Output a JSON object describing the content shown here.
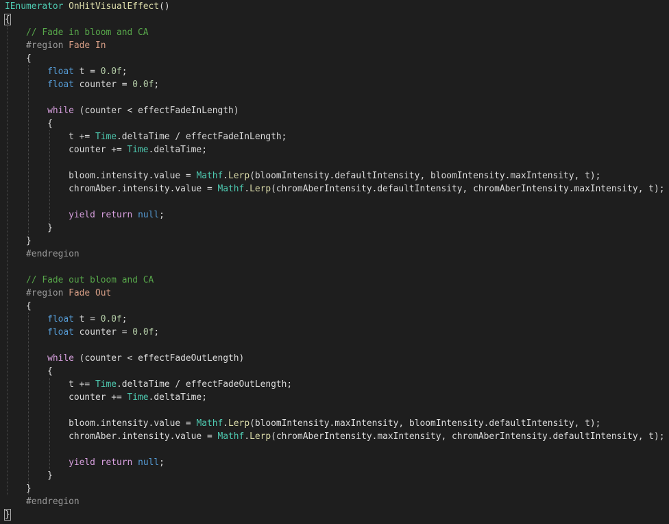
{
  "editor": {
    "lines": [
      [
        [
          "IEnumerator",
          "type"
        ],
        [
          " ",
          "op"
        ],
        [
          "OnHitVisualEffect",
          "fn"
        ],
        [
          "()",
          "op"
        ]
      ],
      [
        [
          "{",
          "op"
        ]
      ],
      [
        [
          "    ",
          "op"
        ],
        [
          "// Fade in bloom and CA",
          "cm"
        ]
      ],
      [
        [
          "    ",
          "op"
        ],
        [
          "#region",
          "pp"
        ],
        [
          " ",
          "op"
        ],
        [
          "Fade In",
          "rn"
        ]
      ],
      [
        [
          "    ",
          "op"
        ],
        [
          "{",
          "op"
        ]
      ],
      [
        [
          "        ",
          "op"
        ],
        [
          "float",
          "kw"
        ],
        [
          " ",
          "op"
        ],
        [
          "t",
          "var"
        ],
        [
          " = ",
          "op"
        ],
        [
          "0.0f",
          "num"
        ],
        [
          ";",
          "op"
        ]
      ],
      [
        [
          "        ",
          "op"
        ],
        [
          "float",
          "kw"
        ],
        [
          " ",
          "op"
        ],
        [
          "counter",
          "var"
        ],
        [
          " = ",
          "op"
        ],
        [
          "0.0f",
          "num"
        ],
        [
          ";",
          "op"
        ]
      ],
      [],
      [
        [
          "        ",
          "op"
        ],
        [
          "while",
          "ctrl"
        ],
        [
          " (",
          "op"
        ],
        [
          "counter",
          "var"
        ],
        [
          " < ",
          "op"
        ],
        [
          "effectFadeInLength",
          "var"
        ],
        [
          ")",
          "op"
        ]
      ],
      [
        [
          "        ",
          "op"
        ],
        [
          "{",
          "op"
        ]
      ],
      [
        [
          "            ",
          "op"
        ],
        [
          "t",
          "var"
        ],
        [
          " += ",
          "op"
        ],
        [
          "Time",
          "type"
        ],
        [
          ".",
          "op"
        ],
        [
          "deltaTime",
          "var"
        ],
        [
          " / ",
          "op"
        ],
        [
          "effectFadeInLength",
          "var"
        ],
        [
          ";",
          "op"
        ]
      ],
      [
        [
          "            ",
          "op"
        ],
        [
          "counter",
          "var"
        ],
        [
          " += ",
          "op"
        ],
        [
          "Time",
          "type"
        ],
        [
          ".",
          "op"
        ],
        [
          "deltaTime",
          "var"
        ],
        [
          ";",
          "op"
        ]
      ],
      [],
      [
        [
          "            ",
          "op"
        ],
        [
          "bloom",
          "var"
        ],
        [
          ".",
          "op"
        ],
        [
          "intensity",
          "var"
        ],
        [
          ".",
          "op"
        ],
        [
          "value",
          "var"
        ],
        [
          " = ",
          "op"
        ],
        [
          "Mathf",
          "type"
        ],
        [
          ".",
          "op"
        ],
        [
          "Lerp",
          "fn"
        ],
        [
          "(",
          "op"
        ],
        [
          "bloomIntensity",
          "var"
        ],
        [
          ".",
          "op"
        ],
        [
          "defaultIntensity",
          "var"
        ],
        [
          ", ",
          "op"
        ],
        [
          "bloomIntensity",
          "var"
        ],
        [
          ".",
          "op"
        ],
        [
          "maxIntensity",
          "var"
        ],
        [
          ", ",
          "op"
        ],
        [
          "t",
          "var"
        ],
        [
          ");",
          "op"
        ]
      ],
      [
        [
          "            ",
          "op"
        ],
        [
          "chromAber",
          "var"
        ],
        [
          ".",
          "op"
        ],
        [
          "intensity",
          "var"
        ],
        [
          ".",
          "op"
        ],
        [
          "value",
          "var"
        ],
        [
          " = ",
          "op"
        ],
        [
          "Mathf",
          "type"
        ],
        [
          ".",
          "op"
        ],
        [
          "Lerp",
          "fn"
        ],
        [
          "(",
          "op"
        ],
        [
          "chromAberIntensity",
          "var"
        ],
        [
          ".",
          "op"
        ],
        [
          "defaultIntensity",
          "var"
        ],
        [
          ", ",
          "op"
        ],
        [
          "chromAberIntensity",
          "var"
        ],
        [
          ".",
          "op"
        ],
        [
          "maxIntensity",
          "var"
        ],
        [
          ", ",
          "op"
        ],
        [
          "t",
          "var"
        ],
        [
          ");",
          "op"
        ]
      ],
      [],
      [
        [
          "            ",
          "op"
        ],
        [
          "yield",
          "ctrl"
        ],
        [
          " ",
          "op"
        ],
        [
          "return",
          "ctrl"
        ],
        [
          " ",
          "op"
        ],
        [
          "null",
          "kw"
        ],
        [
          ";",
          "op"
        ]
      ],
      [
        [
          "        ",
          "op"
        ],
        [
          "}",
          "op"
        ]
      ],
      [
        [
          "    ",
          "op"
        ],
        [
          "}",
          "op"
        ]
      ],
      [
        [
          "    ",
          "op"
        ],
        [
          "#endregion",
          "pp"
        ]
      ],
      [],
      [
        [
          "    ",
          "op"
        ],
        [
          "// Fade out bloom and CA",
          "cm"
        ]
      ],
      [
        [
          "    ",
          "op"
        ],
        [
          "#region",
          "pp"
        ],
        [
          " ",
          "op"
        ],
        [
          "Fade Out",
          "rn"
        ]
      ],
      [
        [
          "    ",
          "op"
        ],
        [
          "{",
          "op"
        ]
      ],
      [
        [
          "        ",
          "op"
        ],
        [
          "float",
          "kw"
        ],
        [
          " ",
          "op"
        ],
        [
          "t",
          "var"
        ],
        [
          " = ",
          "op"
        ],
        [
          "0.0f",
          "num"
        ],
        [
          ";",
          "op"
        ]
      ],
      [
        [
          "        ",
          "op"
        ],
        [
          "float",
          "kw"
        ],
        [
          " ",
          "op"
        ],
        [
          "counter",
          "var"
        ],
        [
          " = ",
          "op"
        ],
        [
          "0.0f",
          "num"
        ],
        [
          ";",
          "op"
        ]
      ],
      [],
      [
        [
          "        ",
          "op"
        ],
        [
          "while",
          "ctrl"
        ],
        [
          " (",
          "op"
        ],
        [
          "counter",
          "var"
        ],
        [
          " < ",
          "op"
        ],
        [
          "effectFadeOutLength",
          "var"
        ],
        [
          ")",
          "op"
        ]
      ],
      [
        [
          "        ",
          "op"
        ],
        [
          "{",
          "op"
        ]
      ],
      [
        [
          "            ",
          "op"
        ],
        [
          "t",
          "var"
        ],
        [
          " += ",
          "op"
        ],
        [
          "Time",
          "type"
        ],
        [
          ".",
          "op"
        ],
        [
          "deltaTime",
          "var"
        ],
        [
          " / ",
          "op"
        ],
        [
          "effectFadeOutLength",
          "var"
        ],
        [
          ";",
          "op"
        ]
      ],
      [
        [
          "            ",
          "op"
        ],
        [
          "counter",
          "var"
        ],
        [
          " += ",
          "op"
        ],
        [
          "Time",
          "type"
        ],
        [
          ".",
          "op"
        ],
        [
          "deltaTime",
          "var"
        ],
        [
          ";",
          "op"
        ]
      ],
      [],
      [
        [
          "            ",
          "op"
        ],
        [
          "bloom",
          "var"
        ],
        [
          ".",
          "op"
        ],
        [
          "intensity",
          "var"
        ],
        [
          ".",
          "op"
        ],
        [
          "value",
          "var"
        ],
        [
          " = ",
          "op"
        ],
        [
          "Mathf",
          "type"
        ],
        [
          ".",
          "op"
        ],
        [
          "Lerp",
          "fn"
        ],
        [
          "(",
          "op"
        ],
        [
          "bloomIntensity",
          "var"
        ],
        [
          ".",
          "op"
        ],
        [
          "maxIntensity",
          "var"
        ],
        [
          ", ",
          "op"
        ],
        [
          "bloomIntensity",
          "var"
        ],
        [
          ".",
          "op"
        ],
        [
          "defaultIntensity",
          "var"
        ],
        [
          ", ",
          "op"
        ],
        [
          "t",
          "var"
        ],
        [
          ");",
          "op"
        ]
      ],
      [
        [
          "            ",
          "op"
        ],
        [
          "chromAber",
          "var"
        ],
        [
          ".",
          "op"
        ],
        [
          "intensity",
          "var"
        ],
        [
          ".",
          "op"
        ],
        [
          "value",
          "var"
        ],
        [
          " = ",
          "op"
        ],
        [
          "Mathf",
          "type"
        ],
        [
          ".",
          "op"
        ],
        [
          "Lerp",
          "fn"
        ],
        [
          "(",
          "op"
        ],
        [
          "chromAberIntensity",
          "var"
        ],
        [
          ".",
          "op"
        ],
        [
          "maxIntensity",
          "var"
        ],
        [
          ", ",
          "op"
        ],
        [
          "chromAberIntensity",
          "var"
        ],
        [
          ".",
          "op"
        ],
        [
          "defaultIntensity",
          "var"
        ],
        [
          ", ",
          "op"
        ],
        [
          "t",
          "var"
        ],
        [
          ");",
          "op"
        ]
      ],
      [],
      [
        [
          "            ",
          "op"
        ],
        [
          "yield",
          "ctrl"
        ],
        [
          " ",
          "op"
        ],
        [
          "return",
          "ctrl"
        ],
        [
          " ",
          "op"
        ],
        [
          "null",
          "kw"
        ],
        [
          ";",
          "op"
        ]
      ],
      [
        [
          "        ",
          "op"
        ],
        [
          "}",
          "op"
        ]
      ],
      [
        [
          "    ",
          "op"
        ],
        [
          "}",
          "op"
        ]
      ],
      [
        [
          "    ",
          "op"
        ],
        [
          "#endregion",
          "pp"
        ]
      ],
      [
        [
          "}",
          "op"
        ]
      ]
    ],
    "colors": {
      "background": "#1e1e1e",
      "type": "#4ec9b0",
      "function": "#dcdcaa",
      "keyword": "#569cd6",
      "control": "#d8a0df",
      "number": "#b5cea8",
      "comment": "#57a64a",
      "preprocessor": "#9b9b9b",
      "region_name": "#d69d85",
      "text": "#dcdcdc"
    }
  }
}
